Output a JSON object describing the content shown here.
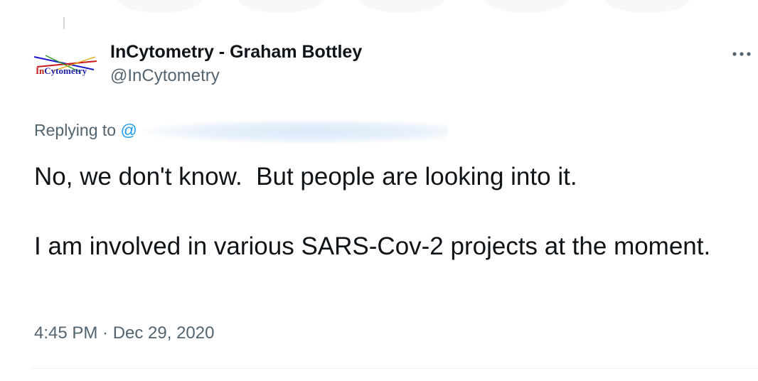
{
  "tweet": {
    "author": {
      "display_name": "InCytometry - Graham Bottley",
      "handle": "@InCytometry",
      "avatar_text": "InCytometry"
    },
    "reply": {
      "prefix": "Replying to",
      "target": "@"
    },
    "text": "No, we don't know.  But people are looking into it.\n\nI am involved in various SARS-Cov-2 projects at the moment.",
    "timestamp": "4:45 PM · Dec 29, 2020",
    "more_icon": "more-horizontal-icon"
  },
  "colors": {
    "text_primary": "#0f1419",
    "text_secondary": "#536471",
    "link": "#1d9bf0",
    "divider": "#eff3f4"
  }
}
